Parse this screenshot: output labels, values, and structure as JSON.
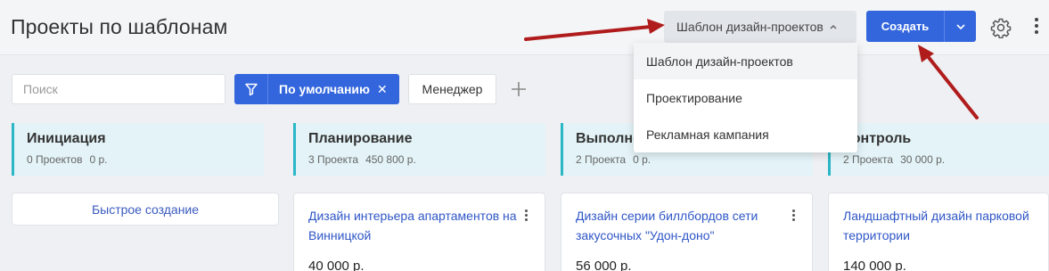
{
  "header": {
    "title": "Проекты по шаблонам",
    "template_select": "Шаблон дизайн-проектов",
    "create_label": "Создать"
  },
  "filters": {
    "search_placeholder": "Поиск",
    "active_filter": "По умолчанию",
    "manager": "Менеджер"
  },
  "dropdown": {
    "options": [
      "Шаблон дизайн-проектов",
      "Проектирование",
      "Рекламная кампания"
    ],
    "selected": "Шаблон дизайн-проектов"
  },
  "columns": [
    {
      "name": "Инициация",
      "count": "0 Проектов",
      "sum": "0 р."
    },
    {
      "name": "Планирование",
      "count": "3 Проекта",
      "sum": "450 800 р."
    },
    {
      "name": "Выполнение",
      "count": "2 Проекта",
      "sum": "0 р."
    },
    {
      "name": "Контроль",
      "count": "2 Проекта",
      "sum": "30 000 р."
    }
  ],
  "quick_create": "Быстрое создание",
  "cards": [
    {
      "title": "Дизайн интерьера апартаментов на Винницкой",
      "value": "40 000 р."
    },
    {
      "title": "Дизайн серии биллбордов сети закусочных \"Удон-доно\"",
      "value": "56 000 р."
    },
    {
      "title": "Ландшафтный дизайн парковой территории",
      "value": "140 000 р."
    }
  ],
  "colors": {
    "primary": "#3366dd",
    "stage_accent": "#2bb7c6",
    "stage_bg": "#e3f3f7",
    "arrow": "#b01c1c",
    "link": "#2f56c6"
  }
}
